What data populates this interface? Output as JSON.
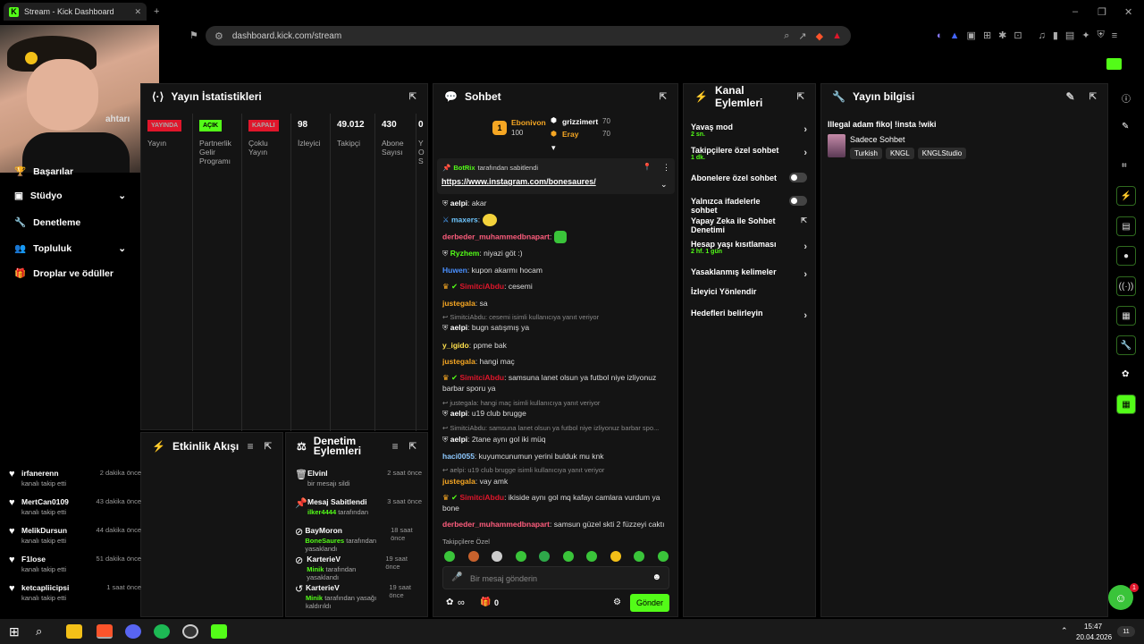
{
  "browser": {
    "tab_title": "Stream - Kick Dashboard",
    "url": "dashboard.kick.com/stream"
  },
  "sidebar": {
    "items": [
      {
        "label": "Başarılar"
      },
      {
        "label": "Stüdyo"
      },
      {
        "label": "Denetleme"
      },
      {
        "label": "Topluluk"
      },
      {
        "label": "Droplar ve ödüller"
      }
    ],
    "partial_label": "ahtarı"
  },
  "stats": {
    "title": "Yayın İstatistikleri",
    "columns": [
      {
        "badge": "YAYINDA",
        "badge_color": "#e0162b",
        "label": "Yayın"
      },
      {
        "badge": "AÇIK",
        "badge_color": "#53fc18",
        "label": "Partnerlik Gelir Programı"
      },
      {
        "badge": "KAPALI",
        "badge_color": "#e0162b",
        "label": "Çoklu Yayın"
      },
      {
        "value": "98",
        "label": "İzleyici"
      },
      {
        "value": "49.012",
        "label": "Takipçi"
      },
      {
        "value": "430",
        "label": "Abone Sayısı"
      },
      {
        "value": "0",
        "label": "Y O S"
      }
    ]
  },
  "events": {
    "title": "Etkinlik Akışı",
    "items": [
      {
        "name": "irfanerenn",
        "sub": "kanalı takip etti",
        "time": "2 dakika önce"
      },
      {
        "name": "MertCan0109",
        "sub": "kanalı takip etti",
        "time": "43 dakika önce"
      },
      {
        "name": "MelikDursun",
        "sub": "kanalı takip etti",
        "time": "44 dakika önce"
      },
      {
        "name": "F1lose",
        "sub": "kanalı takip etti",
        "time": "51 dakika önce"
      },
      {
        "name": "ketcapliicipsi",
        "sub": "kanalı takip etti",
        "time": "1 saat önce"
      }
    ]
  },
  "modactions": {
    "title": "Denetim Eylemleri",
    "items": [
      {
        "name": "Elvinl",
        "actor": "",
        "sub": "bir mesajı sildi",
        "time": "2 saat önce",
        "icon": "trash-icon"
      },
      {
        "name": "Mesaj Sabitlendi",
        "actor": "ilker4444",
        "sub": "tarafından",
        "time": "3 saat önce",
        "icon": "pin-icon"
      },
      {
        "name": "BayMoron",
        "actor": "BoneSaures",
        "sub": "tarafından yasaklandı",
        "time": "18 saat önce",
        "icon": "ban-icon"
      },
      {
        "name": "KarterieV",
        "actor": "Minik",
        "sub": "tarafından yasaklandı",
        "time": "19 saat önce",
        "icon": "ban-icon"
      },
      {
        "name": "KarterieV",
        "actor": "Minik",
        "sub": "tarafından yasağı kaldırıldı",
        "time": "19 saat önce",
        "icon": "undo-icon"
      }
    ]
  },
  "chat": {
    "title": "Sohbet",
    "top_gifters": [
      {
        "name": "Ebonivon",
        "amount": "100",
        "color": "#f5a623"
      },
      {
        "name": "grizzimert",
        "amount": "70",
        "color": "#ffffff"
      },
      {
        "name": "Eray",
        "amount": "70",
        "color": "#f5a623"
      }
    ],
    "rank": "1",
    "pinned": {
      "by_user": "BotRix",
      "by_suffix": "tarafından sabitlendi",
      "link": "https://www.instagram.com/bonesaures/"
    },
    "messages": [
      {
        "user": "aelpi",
        "color": "#ffffff",
        "text": "akar"
      },
      {
        "user": "maxers",
        "color": "#6ec6ff",
        "text": ""
      },
      {
        "user": "derbeder_muhammedbnapart",
        "color": "#ff5d7d",
        "text": ""
      },
      {
        "user": "Ryzhem",
        "color": "#53fc18",
        "text": "niyazi göt :)"
      },
      {
        "user": "Huwen",
        "color": "#4a90ff",
        "text": "kupon akarmı hocam"
      },
      {
        "user": "SimitciAbdu",
        "color": "#e0162b",
        "text": "cesemi"
      },
      {
        "user": "justegala",
        "color": "#f5a623",
        "text": "sa"
      },
      {
        "reply": "SimitciAbdu: cesemi isimli kullanıcıya yanıt veriyor"
      },
      {
        "user": "aelpi",
        "color": "#ffffff",
        "text": "bugn satışmış ya"
      },
      {
        "user": "y_igido",
        "color": "#ffe14d",
        "text": "ppme bak"
      },
      {
        "user": "justegala",
        "color": "#f5a623",
        "text": "hangi maç"
      },
      {
        "user": "SimitciAbdu",
        "color": "#e0162b",
        "text": "samsuna lanet olsun ya futbol niye izliyonuz barbar sporu ya"
      },
      {
        "reply": "justegala: hangi maç isimli kullanıcıya yanıt veriyor"
      },
      {
        "user": "aelpi",
        "color": "#ffffff",
        "text": "u19 club brugge"
      },
      {
        "reply": "SimitciAbdu: samsuna lanet olsun ya futbol niye izliyonuz barbar spo..."
      },
      {
        "user": "aelpi",
        "color": "#ffffff",
        "text": "2tane aynı gol iki müq"
      },
      {
        "user": "haci0055",
        "color": "#8ec9ff",
        "text": "kuyumcunumun yerini bulduk mu knk"
      },
      {
        "reply": "aelpi: u19 club brugge isimli kullanıcıya yanıt veriyor"
      },
      {
        "user": "justegala",
        "color": "#f5a623",
        "text": "vay amk"
      },
      {
        "user": "SimitciAbdu",
        "color": "#e0162b",
        "text": "ikiside aynı gol mq kafayı camlara vurdum ya bone"
      },
      {
        "user": "derbeder_muhammedbnapart",
        "color": "#ff5d7d",
        "text": "samsun güzel skti 2 füzzeyi caktı"
      }
    ],
    "followers_only": "Takipçilere Özel",
    "input_placeholder": "Bir mesaj gönderin",
    "points": "∞",
    "gift_count": "0",
    "send_label": "Gönder"
  },
  "channel_actions": {
    "title": "Kanal Eylemleri",
    "items": [
      {
        "label": "Yavaş mod",
        "sub": "2 sn.",
        "control": "chevron"
      },
      {
        "label": "Takipçilere özel sohbet",
        "sub": "1 dk.",
        "control": "chevron"
      },
      {
        "label": "Abonelere özel sohbet",
        "sub": "",
        "control": "toggle"
      },
      {
        "label": "Yalnızca ifadelerle sohbet",
        "sub": "",
        "control": "toggle"
      },
      {
        "label": "Yapay Zeka ile Sohbet Denetimi",
        "sub": "",
        "control": "external"
      },
      {
        "label": "Hesap yaşı kısıtlaması",
        "sub": "2 hf. 1 gün",
        "control": "chevron"
      },
      {
        "label": "Yasaklanmış kelimeler",
        "sub": "",
        "control": "chevron"
      },
      {
        "label": "İzleyici Yönlendir",
        "sub": "",
        "control": "none"
      },
      {
        "label": "Hedefleri belirleyin",
        "sub": "",
        "control": "chevron"
      }
    ]
  },
  "stream_info": {
    "title": "Yayın bilgisi",
    "stream_title": "Illegal adam fiko| !insta !wiki",
    "category": "Sadece Sohbet",
    "tags": [
      "Turkish",
      "KNGL",
      "KNGLStudio"
    ]
  },
  "taskbar": {
    "time": "15:47",
    "date": "20.04.2026",
    "notif_count": "11"
  },
  "help_badge": "1",
  "colors": {
    "accent": "#53fc18",
    "live": "#e0162b"
  }
}
